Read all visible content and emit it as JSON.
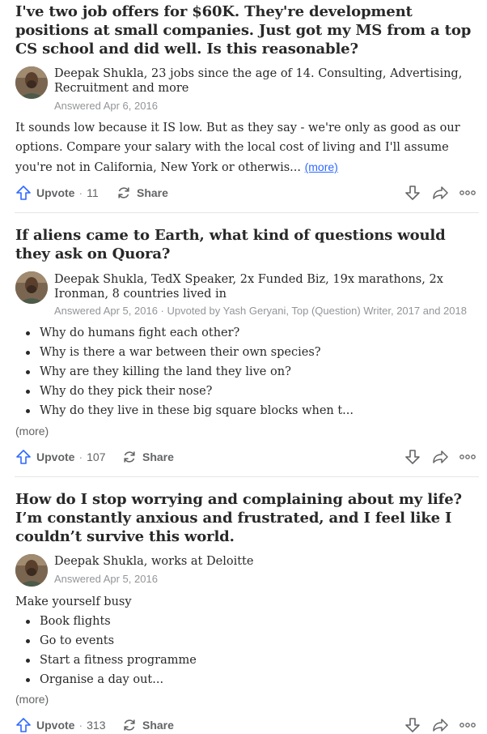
{
  "cards": [
    {
      "question": "I've two job offers for $60K. They're development positions at small companies. Just got my MS from a top CS school and did well. Is this reasonable?",
      "author": "Deepak Shukla, 23 jobs since the age of 14. Consulting, Advertising, Recruitment and more",
      "meta": "Answered Apr 6, 2016",
      "body": "It sounds low because it IS low. But as they say - we're only as good as our options. Compare your salary with the local cost of living and I'll assume you're not in California, New York or otherwis...",
      "more_label": "(more)",
      "upvote_label": "Upvote",
      "upvote_count": "11",
      "share_label": "Share"
    },
    {
      "question": "If aliens came to Earth, what kind of questions would they ask on Quora?",
      "author": "Deepak Shukla, TedX Speaker, 2x Funded Biz, 19x marathons, 2x Ironman, 8 countries lived in",
      "meta": "Answered Apr 5, 2016 · Upvoted by Yash Geryani, Top (Question) Writer, 2017 and 2018",
      "bullets": [
        "Why do humans fight each other?",
        "Why is there a war between their own species?",
        "Why are they killing the land they live on?",
        "Why do they pick their nose?",
        "Why do they live in these big square blocks when t..."
      ],
      "more_label": "(more)",
      "upvote_label": "Upvote",
      "upvote_count": "107",
      "share_label": "Share"
    },
    {
      "question": "How do I stop worrying and complaining about my life? I’m constantly anxious and frustrated, and I feel like I couldn’t survive this world.",
      "author": "Deepak Shukla, works at Deloitte",
      "meta": "Answered Apr 5, 2016",
      "intro": "Make yourself busy",
      "bullets": [
        "Book flights",
        "Go to events",
        "Start a fitness programme",
        "Organise a day out..."
      ],
      "more_label": "(more)",
      "upvote_label": "Upvote",
      "upvote_count": "313",
      "share_label": "Share"
    }
  ],
  "icons": {
    "upvote": "upvote-arrow-icon",
    "share": "share-refresh-icon",
    "downvote": "downvote-arrow-icon",
    "forward": "forward-arrow-icon",
    "more": "more-horizontal-icon"
  },
  "colors": {
    "link": "#2e69ff",
    "muted": "#939598",
    "action": "#636466",
    "text": "#282829"
  }
}
